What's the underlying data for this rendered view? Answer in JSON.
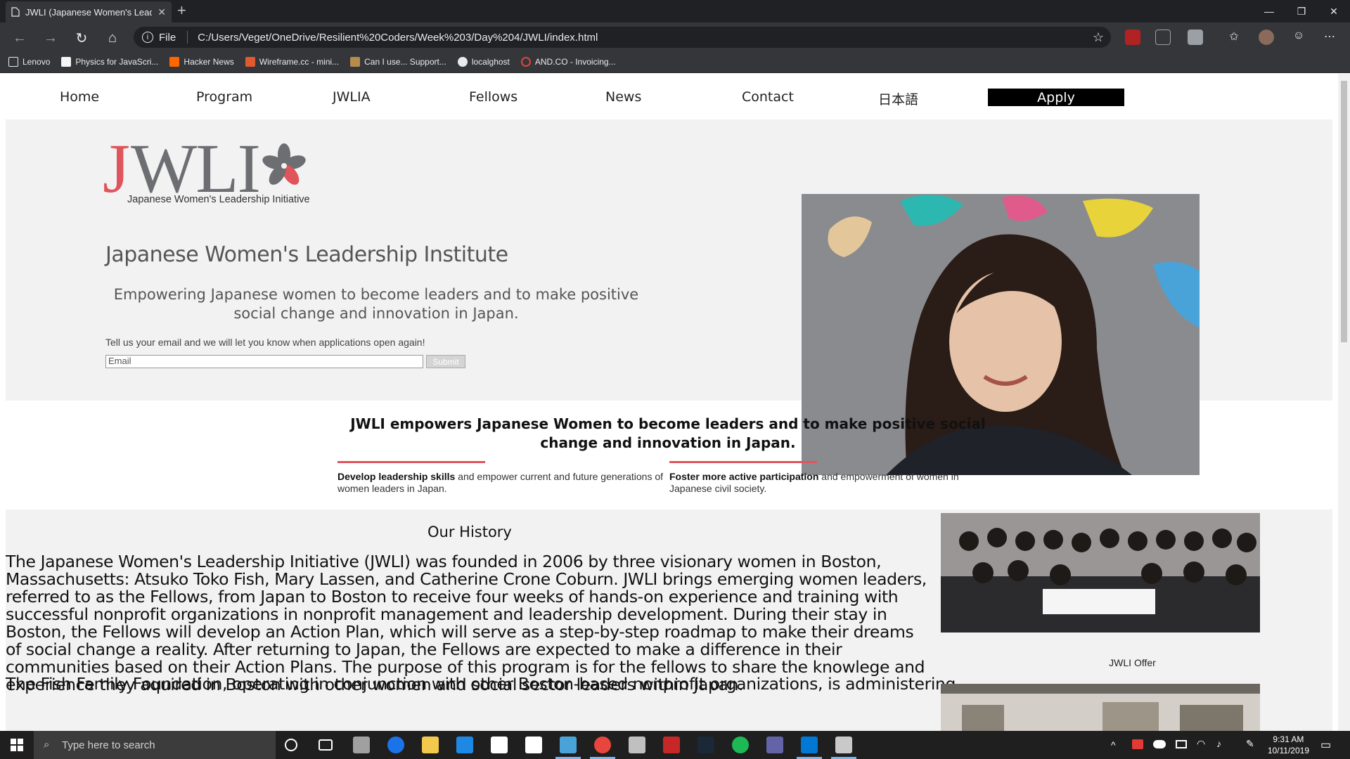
{
  "browser": {
    "tab_title": "JWLI (Japanese Women's Leader",
    "tab_close": "✕",
    "new_tab": "+",
    "file_label": "File",
    "url": "C:/Users/Veget/OneDrive/Resilient%20Coders/Week%203/Day%204/JWLI/index.html",
    "bookmarks": [
      {
        "label": "Lenovo",
        "color": "#888888"
      },
      {
        "label": "Physics for JavaScri...",
        "color": "#f5f5f5"
      },
      {
        "label": "Hacker News",
        "color": "#ff6600"
      },
      {
        "label": "Wireframe.cc - mini...",
        "color": "#e05a30"
      },
      {
        "label": "Can I use... Support...",
        "color": "#b68c4c"
      },
      {
        "label": "localghost",
        "color": "#e8eaed"
      },
      {
        "label": "AND.CO - Invoicing...",
        "color": "#e0453a"
      }
    ]
  },
  "nav": {
    "items": [
      "Home",
      "Program",
      "JWLIA",
      "Fellows",
      "News",
      "Contact",
      "日本語"
    ],
    "apply": "Apply"
  },
  "hero": {
    "logo_j": "J",
    "logo_wli": "WLI",
    "logo_tagline": "Japanese Women's Leadership Initiative",
    "title": "Japanese Women's Leadership Institute",
    "subtitle": "Empowering Japanese women to become leaders and to make positive social change and innovation in Japan.",
    "email_prompt": "Tell us your email and we will let you know when applications open again!",
    "email_placeholder": "Email",
    "submit_label": "Submit"
  },
  "mission": {
    "statement": "JWLI empowers Japanese Women to become leaders and to make positive social change and innovation in Japan.",
    "pillars": [
      {
        "bold": "Develop leadership skills",
        "text": " and empower current and future generations of women leaders in Japan."
      },
      {
        "bold": "Foster more active participation",
        "text": " and empowerment of women in Japanese civil society."
      }
    ]
  },
  "history": {
    "heading": "Our History",
    "p1": "The Japanese Women's Leadership Initiative (JWLI) was founded in 2006 by three visionary women in Boston, Massachusetts: Atsuko Toko Fish, Mary Lassen, and Catherine Crone Coburn. JWLI brings emerging women leaders, referred to as the Fellows, from Japan to Boston to receive four weeks of hands-on experience and training with successful nonprofit organizations in nonprofit management and leadership development. During their stay in Boston, the Fellows will develop an Action Plan, which will serve as a step-by-step roadmap to make their dreams of social change a reality. After returning to Japan, the Fellows are expected to make a difference in their communities based on their Action Plans. The purpose of this program is for the fellows to share the knowlege and experience they aquired in Boston with other women and social sector leaders within Japan.",
    "p2": "The Fish Family Foundation, operating in conjunction with other Boston-based nonprofit organizations, is administering",
    "offer_caption": "JWLI Offer"
  },
  "taskbar": {
    "search_placeholder": "Type here to search",
    "time": "9:31 AM",
    "date": "10/11/2019"
  }
}
